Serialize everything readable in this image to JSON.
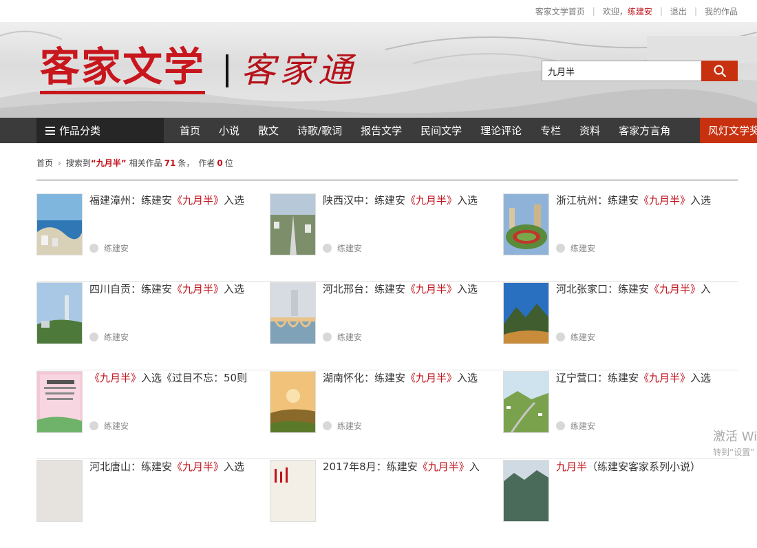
{
  "topbar": {
    "home_link": "客家文学首页",
    "welcome": "欢迎，",
    "username": "练建安",
    "logout": "退出",
    "my_works": "我的作品"
  },
  "header": {
    "logo_text": "客家文学",
    "logo_sub": "客家通",
    "search_value": "九月半",
    "search_icon": "search-icon"
  },
  "nav": {
    "category_label": "作品分类",
    "items": [
      "首页",
      "小说",
      "散文",
      "诗歌/歌词",
      "报告文学",
      "民间文学",
      "理论评论",
      "专栏",
      "资料",
      "客家方言角"
    ],
    "special": "风灯文学奖"
  },
  "crumb": {
    "home": "首页",
    "searched": "搜索到",
    "keyword": "“九月半”",
    "related": "相关作品",
    "works_count": "71",
    "unit_tiao": "条，",
    "authors": "作者",
    "authors_count": "0",
    "unit_wei": "位"
  },
  "results": [
    {
      "prefix": "福建漳州：练建安",
      "hl": "《九月半》",
      "suffix": "入选",
      "author": "练建安",
      "thumb": "coast"
    },
    {
      "prefix": "陕西汉中：练建安",
      "hl": "《九月半》",
      "suffix": "入选",
      "author": "练建安",
      "thumb": "city"
    },
    {
      "prefix": "浙江杭州：练建安",
      "hl": "《九月半》",
      "suffix": "入选",
      "author": "练建安",
      "thumb": "stadium"
    },
    {
      "prefix": "四川自贡：练建安",
      "hl": "《九月半》",
      "suffix": "入选",
      "author": "练建安",
      "thumb": "tower"
    },
    {
      "prefix": "河北邢台：练建安",
      "hl": "《九月半》",
      "suffix": "入选",
      "author": "练建安",
      "thumb": "bridge"
    },
    {
      "prefix": "河北张家口：练建安",
      "hl": "《九月半》",
      "suffix": "入",
      "author": "练建安",
      "thumb": "mountain"
    },
    {
      "prefix": "",
      "hl": "《九月半》",
      "suffix": "入选《过目不忘：50则",
      "author": "练建安",
      "thumb": "book"
    },
    {
      "prefix": "湖南怀化：练建安",
      "hl": "《九月半》",
      "suffix": "入选",
      "author": "练建安",
      "thumb": "sunset"
    },
    {
      "prefix": "辽宁营口：练建安",
      "hl": "《九月半》",
      "suffix": "入选",
      "author": "练建安",
      "thumb": "valley"
    },
    {
      "prefix": "河北唐山：练建安",
      "hl": "《九月半》",
      "suffix": "入选",
      "author": "",
      "thumb": "blank"
    },
    {
      "prefix": "2017年8月：练建安",
      "hl": "《九月半》",
      "suffix": "入",
      "author": "",
      "thumb": "poster"
    },
    {
      "prefix": "",
      "hl": "九月半",
      "suffix": "（练建安客家系列小说）",
      "author": "",
      "thumb": "hills"
    }
  ],
  "watermark": {
    "line1": "激活 Wi",
    "line2": "转到“设置”"
  },
  "colors": {
    "brand_red": "#c8161d",
    "highlight": "#c0121b",
    "nav_bg": "#3b3b3b",
    "accent_orange": "#c8310f"
  }
}
